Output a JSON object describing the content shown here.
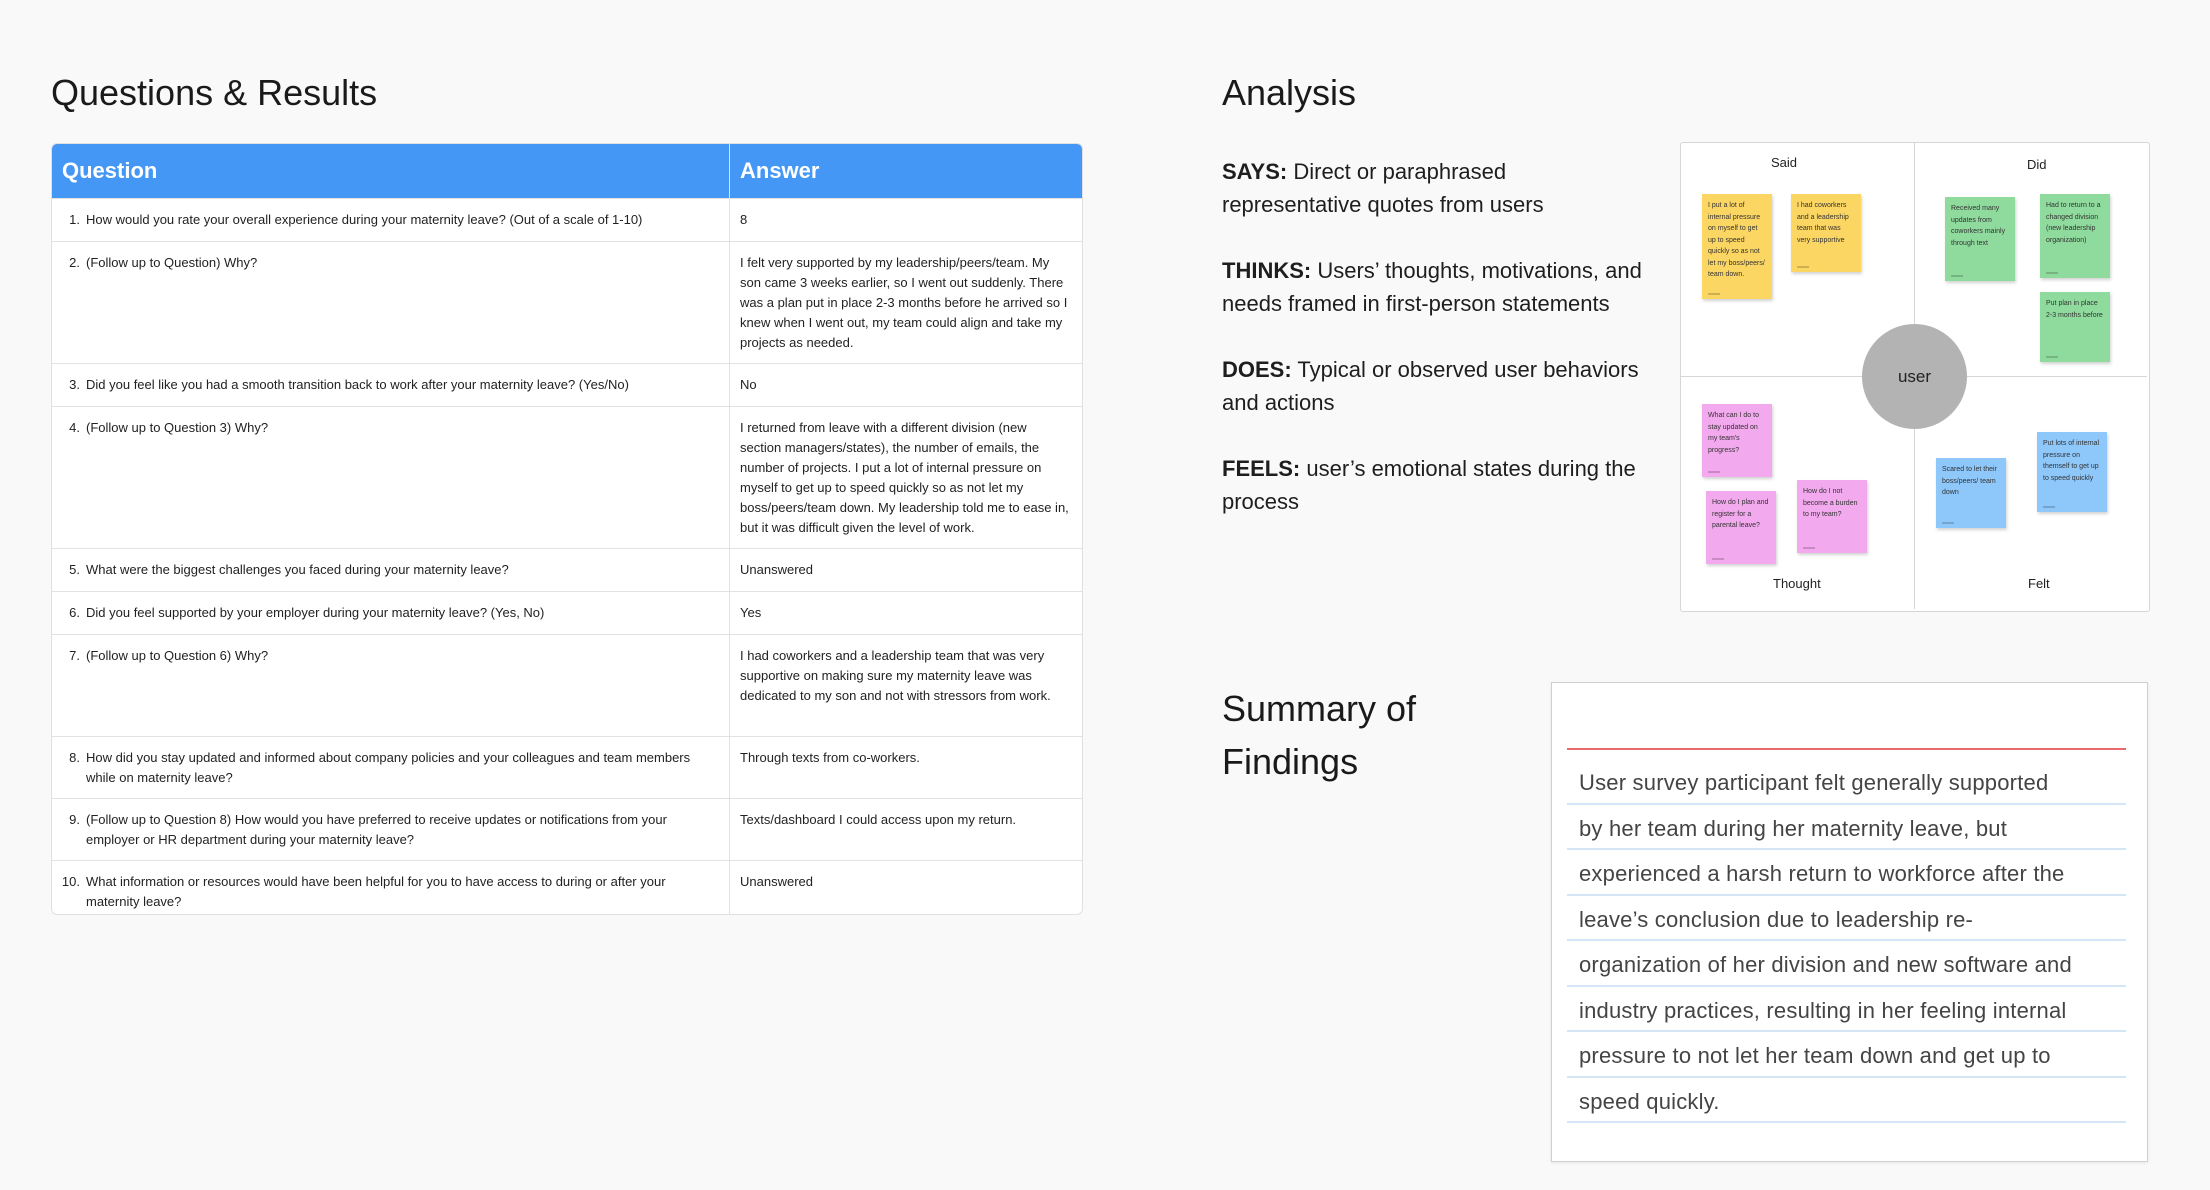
{
  "headings": {
    "questions_results": "Questions & Results",
    "analysis": "Analysis",
    "summary_line1": "Summary of",
    "summary_line2": "Findings"
  },
  "table": {
    "col_question": "Question",
    "col_answer": "Answer",
    "rows": [
      {
        "num": "1.",
        "q": "How would you rate your overall experience during your maternity leave? (Out of a scale of 1-10)",
        "a": "8"
      },
      {
        "num": "2.",
        "q": "(Follow up to Question) Why?",
        "a": "I felt very supported by my leadership/peers/team. My son came 3 weeks earlier, so I went out suddenly. There was a plan put in place 2-3 months before he arrived so I knew when I went out, my team could align and take my projects as needed."
      },
      {
        "num": "3.",
        "q": "Did you feel like you had a smooth transition back to work after your maternity leave? (Yes/No)",
        "a": "No"
      },
      {
        "num": "4.",
        "q": "(Follow up to Question 3) Why?",
        "a": "I returned from leave with a different division (new section managers/states), the number of emails, the number of projects. I put a lot of internal pressure on myself to get up to speed quickly so as not let my boss/peers/team down. My leadership told me to ease in, but it was difficult given the level of work."
      },
      {
        "num": "5.",
        "q": "What were the biggest challenges you faced during your maternity leave?",
        "a": "Unanswered"
      },
      {
        "num": "6.",
        "q": "Did you feel supported by your employer during your maternity leave? (Yes, No)",
        "a": "Yes"
      },
      {
        "num": "7.",
        "q": "(Follow up to Question 6) Why?",
        "a": "I had coworkers and a leadership team that was very supportive on making sure my maternity leave was dedicated to my son and not with stressors from work."
      },
      {
        "num": "8.",
        "q": "How did you stay updated and informed about company policies and your colleagues and team members while on maternity leave?",
        "a": "Through texts from co-workers."
      },
      {
        "num": "9.",
        "q": "(Follow up to Question 8) How would you have preferred to receive updates or notifications from your employer or HR department during your maternity leave?",
        "a": "Texts/dashboard I could access upon my return."
      },
      {
        "num": "10.",
        "q": "What information or resources would have been helpful for you to have access to during or after your maternity leave?",
        "a": "Unanswered"
      }
    ]
  },
  "analysis": [
    {
      "label": "SAYS:",
      "text": "Direct or paraphrased representative quotes from users"
    },
    {
      "label": "THINKS:",
      "text": "Users’ thoughts, motivations, and needs framed in first-person statements"
    },
    {
      "label": "DOES:",
      "text": "Typical or observed user behaviors and actions"
    },
    {
      "label": "FEELS:",
      "text": "user’s emotional states during the process"
    }
  ],
  "map": {
    "said": "Said",
    "did": "Did",
    "thought": "Thought",
    "felt": "Felt",
    "user": "user",
    "stickies": {
      "said1": "I put a lot of internal pressure on myself to get up to speed quickly so as not let my boss/peers/ team down.",
      "said2": "I had coworkers and a leadership team that was very supportive",
      "did1": "Received many updates from coworkers mainly through text",
      "did2": "Had to return to a changed division (new leadership organization)",
      "did3": "Put plan in place 2-3 months before",
      "thought1": "What can I do to stay updated on my team's progress?",
      "thought2": "How do I plan and register for a parental leave?",
      "thought3": "How do I not become a burden to my team?",
      "felt1": "Scared to let their boss/peers/ team down",
      "felt2": "Put lots of internal pressure on themself to get up to speed quickly"
    },
    "colors": {
      "yellow": "#fcd663",
      "green": "#8fdb9e",
      "pink": "#f3a9ee",
      "blue": "#8ec7fa"
    }
  },
  "summary_lines": [
    "User survey participant felt generally supported",
    "by her team during her maternity leave, but",
    "experienced a harsh return to workforce after the",
    "leave’s conclusion due to leadership re-",
    "organization of her division and new software and",
    "industry practices, resulting in her feeling internal",
    "pressure to not let her team down and get up to",
    "speed quickly."
  ],
  "colors": {
    "header_blue": "#4597f6",
    "summary_rule": "#e86a6a",
    "line_blue": "#d4e6f6"
  }
}
